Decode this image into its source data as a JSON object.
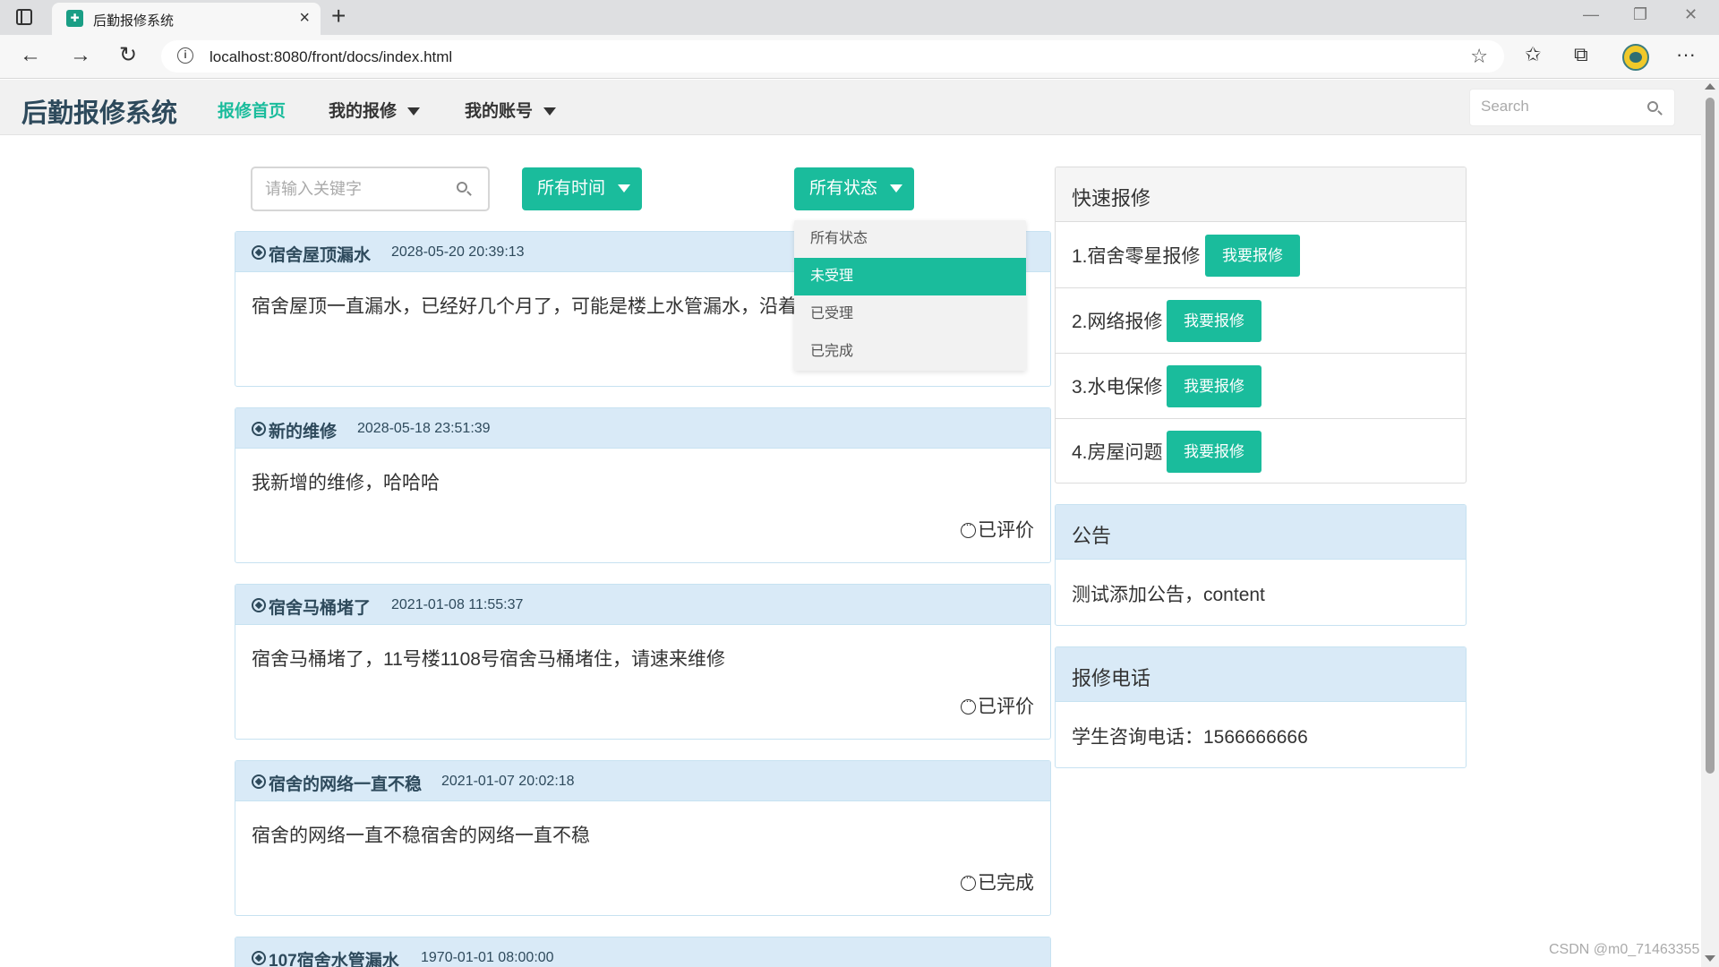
{
  "browser": {
    "tab_title": "后勤报修系统",
    "tab_close": "×",
    "new_tab": "+",
    "url": "localhost:8080/front/docs/index.html",
    "info_icon": "i",
    "back_icon": "←",
    "forward_icon": "→",
    "refresh_icon": "↻",
    "star_icon": "☆",
    "favorites_icon": "✩",
    "collections_icon": "⧉",
    "more_icon": "···",
    "minimize_icon": "—",
    "restore_icon": "❐",
    "window_close_icon": "✕"
  },
  "nav": {
    "brand": "后勤报修系统",
    "links": [
      "报修首页",
      "我的报修",
      "我的账号"
    ],
    "search_placeholder": "Search"
  },
  "filters": {
    "keyword_placeholder": "请输入关键字",
    "time_label": "所有时间",
    "status_label": "所有状态",
    "status_options": [
      "所有状态",
      "未受理",
      "已受理",
      "已完成"
    ],
    "status_highlighted": "未受理"
  },
  "repairs": [
    {
      "title": "宿舍屋顶漏水",
      "time": "2028-05-20 20:39:13",
      "body": "宿舍屋顶一直漏水，已经好几个月了，可能是楼上水管漏水，沿着",
      "status": ""
    },
    {
      "title": "新的维修",
      "time": "2028-05-18 23:51:39",
      "body": "我新增的维修，哈哈哈",
      "status": "已评价"
    },
    {
      "title": "宿舍马桶堵了",
      "time": "2021-01-08 11:55:37",
      "body": "宿舍马桶堵了，11号楼1108号宿舍马桶堵住，请速来维修",
      "status": "已评价"
    },
    {
      "title": "宿舍的网络一直不稳",
      "time": "2021-01-07 20:02:18",
      "body": "宿舍的网络一直不稳宿舍的网络一直不稳",
      "status": "已完成"
    },
    {
      "title": "107宿舍水管漏水",
      "time": "1970-01-01 08:00:00",
      "body": "",
      "status": ""
    }
  ],
  "quick_repair": {
    "title": "快速报修",
    "button_label": "我要报修",
    "items": [
      "1.宿舍零星报修",
      "2.网络报修",
      "3.水电保修",
      "4.房屋问题"
    ]
  },
  "notice": {
    "title": "公告",
    "content": "测试添加公告，content"
  },
  "phone": {
    "title": "报修电话",
    "content": "学生咨询电话：1566666666"
  },
  "footer_mark": "CSDN @m0_71463355",
  "colors": {
    "accent": "#1abc9c",
    "header_blue": "#d9eaf7",
    "brand_text": "#2e4a5c"
  }
}
